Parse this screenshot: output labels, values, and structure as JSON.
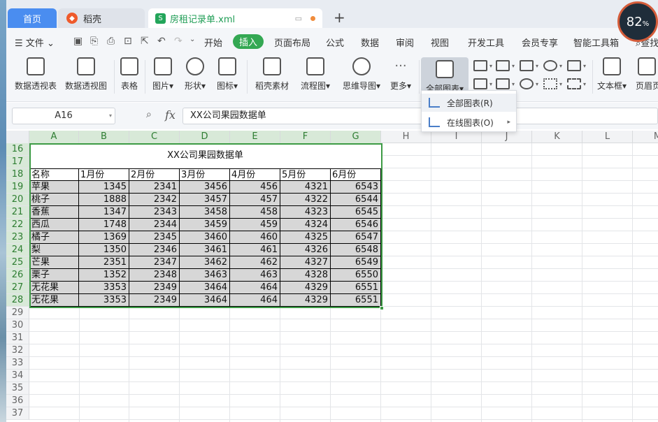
{
  "tabs": {
    "home": "首页",
    "daoke": "稻壳",
    "file": "房租记录单.xml"
  },
  "speed": {
    "value": "82",
    "unit": "%"
  },
  "menu": {
    "file": "文件",
    "items": [
      "开始",
      "插入",
      "页面布局",
      "公式",
      "数据",
      "审阅",
      "视图",
      "开发工具",
      "会员专享",
      "智能工具箱",
      "查找"
    ],
    "active_index": 1
  },
  "ribbon": {
    "pivot_table": "数据透视表",
    "pivot_chart": "数据透视图",
    "table": "表格",
    "picture": "图片",
    "shape": "形状",
    "icon": "图标",
    "daoke_material": "稻壳素材",
    "flowchart": "流程图",
    "mindmap": "思维导图",
    "more": "更多",
    "all_charts": "全部图表",
    "textbox": "文本框",
    "header": "页眉页"
  },
  "dropdown": {
    "all_charts": "全部图表(R)",
    "online_charts": "在线图表(O)"
  },
  "formula_bar": {
    "cell_ref": "A16",
    "fx": "fx",
    "content": "XX公司果园数据单"
  },
  "columns": [
    "A",
    "B",
    "C",
    "D",
    "E",
    "F",
    "G",
    "H",
    "I",
    "J",
    "K",
    "L",
    "M"
  ],
  "rows": [
    "16",
    "17",
    "18",
    "19",
    "20",
    "21",
    "22",
    "23",
    "24",
    "25",
    "26",
    "27",
    "28",
    "29",
    "30",
    "31",
    "32",
    "33",
    "34",
    "35",
    "36",
    "37"
  ],
  "table": {
    "title": "XX公司果园数据单",
    "headers": [
      "名称",
      "1月份",
      "2月份",
      "3月份",
      "4月份",
      "5月份",
      "6月份"
    ],
    "rows": [
      [
        "苹果",
        "1345",
        "2341",
        "3456",
        "456",
        "4321",
        "6543"
      ],
      [
        "桃子",
        "1888",
        "2342",
        "3457",
        "457",
        "4322",
        "6544"
      ],
      [
        "香蕉",
        "1347",
        "2343",
        "3458",
        "458",
        "4323",
        "6545"
      ],
      [
        "西瓜",
        "1748",
        "2344",
        "3459",
        "459",
        "4324",
        "6546"
      ],
      [
        "橘子",
        "1369",
        "2345",
        "3460",
        "460",
        "4325",
        "6547"
      ],
      [
        "梨",
        "1350",
        "2346",
        "3461",
        "461",
        "4326",
        "6548"
      ],
      [
        "芒果",
        "2351",
        "2347",
        "3462",
        "462",
        "4327",
        "6549"
      ],
      [
        "栗子",
        "1352",
        "2348",
        "3463",
        "463",
        "4328",
        "6550"
      ],
      [
        "无花果",
        "3353",
        "2349",
        "3464",
        "464",
        "4329",
        "6551"
      ],
      [
        "无花果",
        "3353",
        "2349",
        "3464",
        "464",
        "4329",
        "6551"
      ]
    ]
  }
}
